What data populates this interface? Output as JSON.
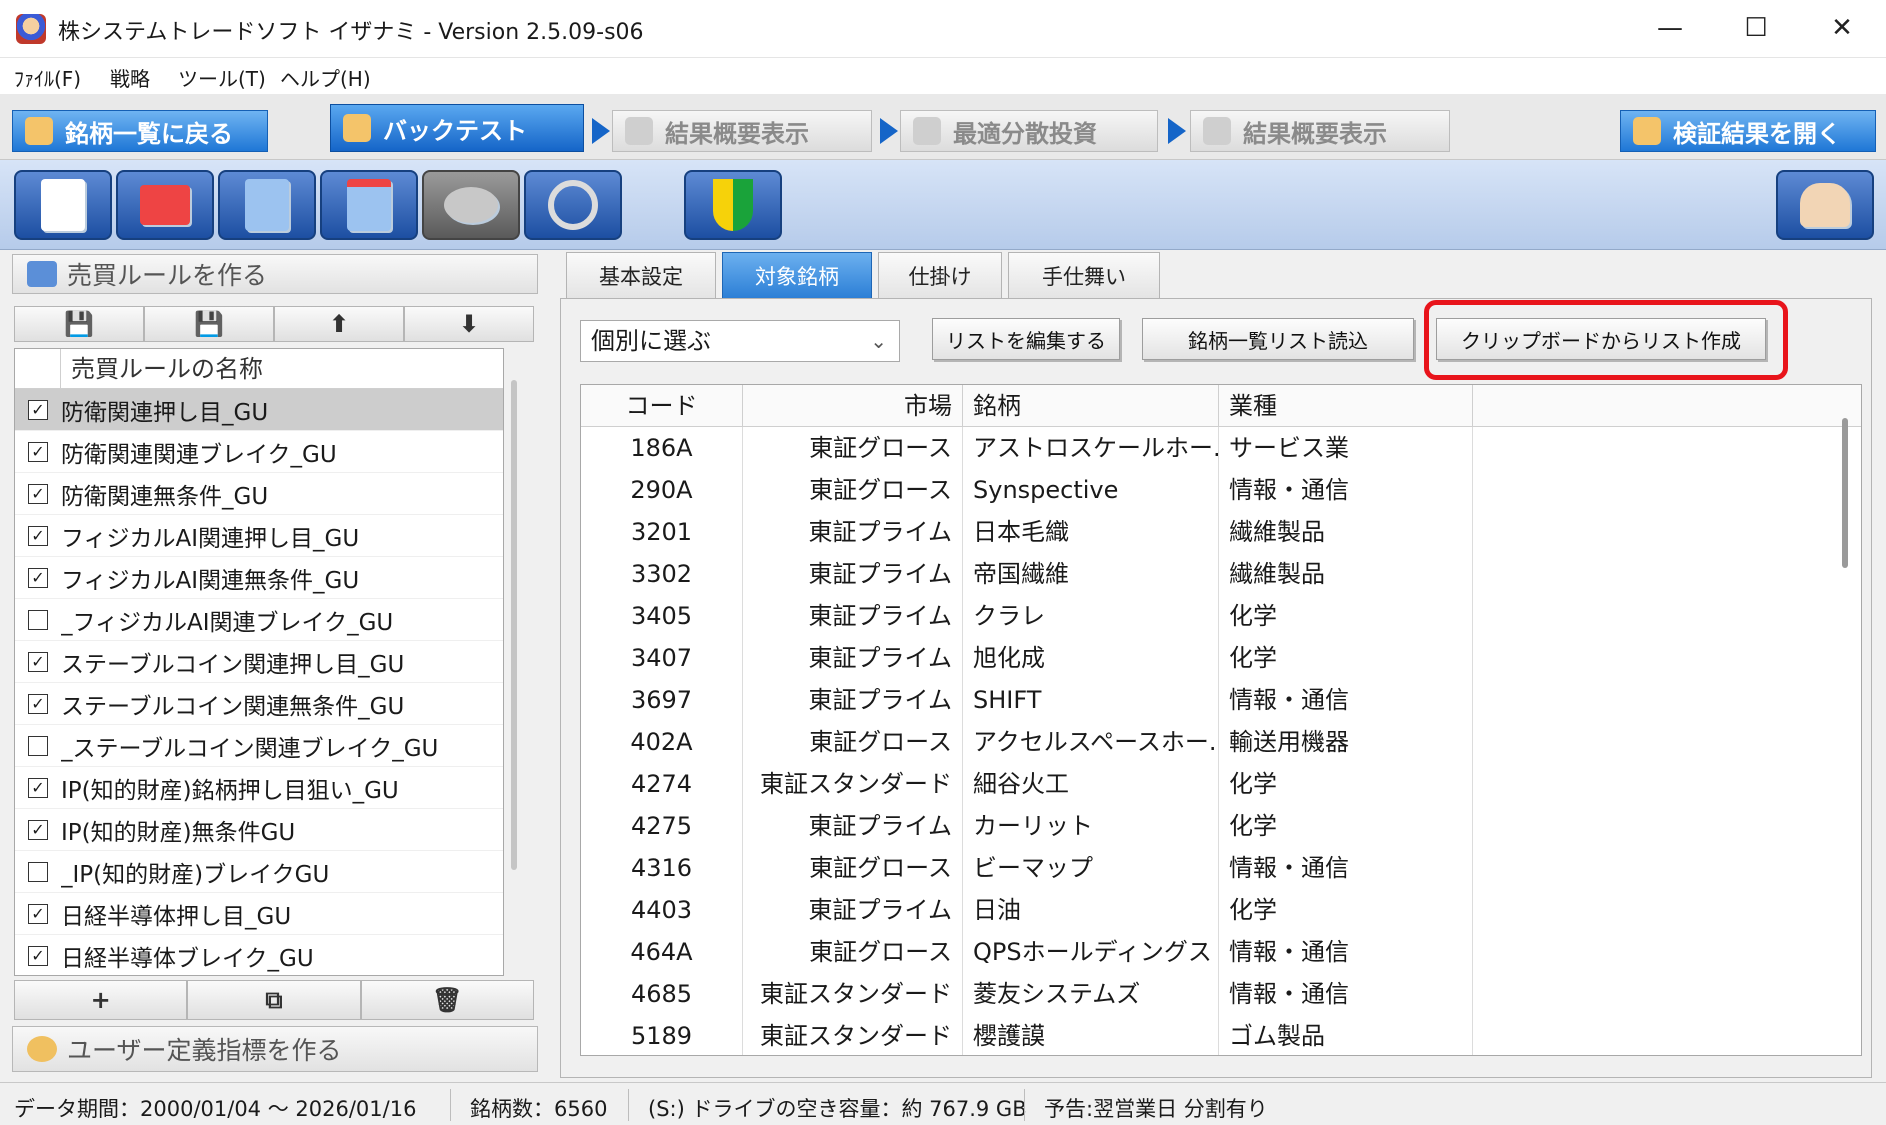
{
  "window": {
    "title": "株システムトレードソフト イザナミ - Version 2.5.09-s06",
    "minimize_glyph": "—",
    "maximize_glyph": "☐",
    "close_glyph": "✕"
  },
  "menu": [
    "ﾌｧｲﾙ(F)",
    "戦略",
    "ツール(T)",
    "ヘルプ(H)"
  ],
  "nav": {
    "back": "銘柄一覧に戻る",
    "backtest": "バックテスト",
    "summary1": "結果概要表示",
    "dispersion": "最適分散投資",
    "summary2": "結果概要表示",
    "open_results": "検証結果を開く",
    "arrow_glyph": "▶"
  },
  "toolbar_icons": [
    "new-document-icon",
    "computer-icon",
    "export-icon",
    "import-icon",
    "paint-icon",
    "tools-icon",
    "beginner-mark-icon",
    "hand-icon"
  ],
  "left": {
    "rule_header": "売買ルールを作る",
    "rule_btns": [
      "💾",
      "💾",
      "⬆",
      "⬇"
    ],
    "rule_col": "売買ルールの名称",
    "rules": [
      {
        "name": "防衛関連押し目_GU",
        "checked": true,
        "selected": true
      },
      {
        "name": "防衛関連関連ブレイク_GU",
        "checked": true
      },
      {
        "name": "防衛関連無条件_GU",
        "checked": true
      },
      {
        "name": "フィジカルAI関連押し目_GU",
        "checked": true
      },
      {
        "name": "フィジカルAI関連無条件_GU",
        "checked": true
      },
      {
        "name": "_フィジカルAI関連ブレイク_GU",
        "checked": false
      },
      {
        "name": "ステーブルコイン関連押し目_GU",
        "checked": true
      },
      {
        "name": "ステーブルコイン関連無条件_GU",
        "checked": true
      },
      {
        "name": "_ステーブルコイン関連ブレイク_GU",
        "checked": false
      },
      {
        "name": "IP(知的財産)銘柄押し目狙い_GU",
        "checked": true
      },
      {
        "name": "IP(知的財産)無条件GU",
        "checked": true
      },
      {
        "name": "_IP(知的財産)ブレイクGU",
        "checked": false
      },
      {
        "name": "日経半導体押し目_GU",
        "checked": true
      },
      {
        "name": "日経半導体ブレイク_GU",
        "checked": true
      }
    ],
    "list_btns": [
      "+",
      "⧉",
      "🗑"
    ],
    "indicator_header": "ユーザー定義指標を作る"
  },
  "tabs": [
    "基本設定",
    "対象銘柄",
    "仕掛け",
    "手仕舞い"
  ],
  "target": {
    "select_value": "個別に選ぶ",
    "edit_list": "リストを編集する",
    "read_list": "銘柄一覧リスト読込",
    "clipboard": "クリップボードからリスト作成",
    "columns": {
      "code": "コード",
      "market": "市場",
      "name": "銘柄",
      "industry": "業種"
    },
    "rows": [
      [
        "186A",
        "東証グロース",
        "アストロスケールホー...",
        "サービス業"
      ],
      [
        "290A",
        "東証グロース",
        "Synspective",
        "情報・通信"
      ],
      [
        "3201",
        "東証プライム",
        "日本毛織",
        "繊維製品"
      ],
      [
        "3302",
        "東証プライム",
        "帝国繊維",
        "繊維製品"
      ],
      [
        "3405",
        "東証プライム",
        "クラレ",
        "化学"
      ],
      [
        "3407",
        "東証プライム",
        "旭化成",
        "化学"
      ],
      [
        "3697",
        "東証プライム",
        "SHIFT",
        "情報・通信"
      ],
      [
        "402A",
        "東証グロース",
        "アクセルスペースホー...",
        "輸送用機器"
      ],
      [
        "4274",
        "東証スタンダード",
        "細谷火工",
        "化学"
      ],
      [
        "4275",
        "東証プライム",
        "カーリット",
        "化学"
      ],
      [
        "4316",
        "東証グロース",
        "ビーマップ",
        "情報・通信"
      ],
      [
        "4403",
        "東証プライム",
        "日油",
        "化学"
      ],
      [
        "464A",
        "東証グロース",
        "QPSホールディングス",
        "情報・通信"
      ],
      [
        "4685",
        "東証スタンダード",
        "菱友システムズ",
        "情報・通信"
      ],
      [
        "5189",
        "東証スタンダード",
        "櫻護謨",
        "ゴム製品"
      ]
    ]
  },
  "status": {
    "period": "データ期間：2000/01/04 〜 2026/01/16",
    "count": "銘柄数：6560",
    "disk": "(S:) ドライブの空き容量：約 767.9 GB",
    "forecast": "予告:翌営業日 分割有り"
  },
  "colors": {
    "accent": "#1565c8",
    "highlight": "#e8141b"
  }
}
